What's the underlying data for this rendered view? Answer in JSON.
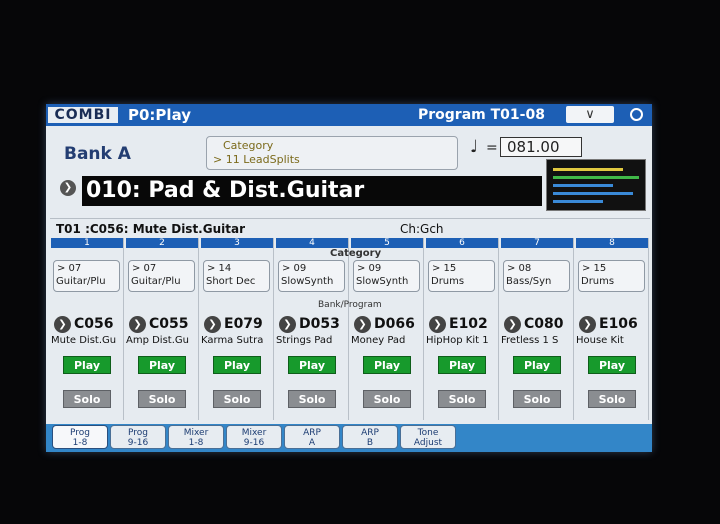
{
  "header": {
    "mode_tab": "COMBI",
    "page_title": "P0:Play",
    "program_range": "Program T01-08"
  },
  "bank": {
    "label": "Bank A"
  },
  "category": {
    "label": "Category",
    "value": "> 11 LeadSplits"
  },
  "tempo": {
    "value": "081.00"
  },
  "combi_name": "010: Pad & Dist.Guitar",
  "info": {
    "selected_program": "T01 :C056: Mute Dist.Guitar",
    "channel": "Ch:Gch"
  },
  "section_labels": {
    "category": "Category",
    "bank_program": "Bank/Program"
  },
  "timbres": [
    {
      "num": "1",
      "cat_num": "> 07",
      "cat_name": "Guitar/Plu",
      "prog_id": "C056",
      "prog_name": "Mute Dist.Gu",
      "play": "Play",
      "solo": "Solo"
    },
    {
      "num": "2",
      "cat_num": "> 07",
      "cat_name": "Guitar/Plu",
      "prog_id": "C055",
      "prog_name": "Amp Dist.Gu",
      "play": "Play",
      "solo": "Solo"
    },
    {
      "num": "3",
      "cat_num": "> 14",
      "cat_name": "Short Dec",
      "prog_id": "E079",
      "prog_name": "Karma Sutra",
      "play": "Play",
      "solo": "Solo"
    },
    {
      "num": "4",
      "cat_num": "> 09",
      "cat_name": "SlowSynth",
      "prog_id": "D053",
      "prog_name": "Strings Pad",
      "play": "Play",
      "solo": "Solo"
    },
    {
      "num": "5",
      "cat_num": "> 09",
      "cat_name": "SlowSynth",
      "prog_id": "D066",
      "prog_name": "Money Pad",
      "play": "Play",
      "solo": "Solo"
    },
    {
      "num": "6",
      "cat_num": "> 15",
      "cat_name": "Drums",
      "prog_id": "E102",
      "prog_name": "HipHop Kit 1",
      "play": "Play",
      "solo": "Solo"
    },
    {
      "num": "7",
      "cat_num": "> 08",
      "cat_name": "Bass/Syn",
      "prog_id": "C080",
      "prog_name": "Fretless 1 S",
      "play": "Play",
      "solo": "Solo"
    },
    {
      "num": "8",
      "cat_num": "> 15",
      "cat_name": "Drums",
      "prog_id": "E106",
      "prog_name": "House Kit",
      "play": "Play",
      "solo": "Solo"
    }
  ],
  "tabs": [
    {
      "l1": "Prog",
      "l2": "1-8",
      "active": true
    },
    {
      "l1": "Prog",
      "l2": "9-16",
      "active": false
    },
    {
      "l1": "Mixer",
      "l2": "1-8",
      "active": false
    },
    {
      "l1": "Mixer",
      "l2": "9-16",
      "active": false
    },
    {
      "l1": "ARP",
      "l2": "A",
      "active": false
    },
    {
      "l1": "ARP",
      "l2": "B",
      "active": false
    },
    {
      "l1": "Tone",
      "l2": "Adjust",
      "active": false
    }
  ],
  "colors": {
    "header_blue": "#1d5fb5",
    "play_green": "#179a2c",
    "solo_gray": "#8a8d91",
    "tabbar_blue": "#3386c8"
  }
}
